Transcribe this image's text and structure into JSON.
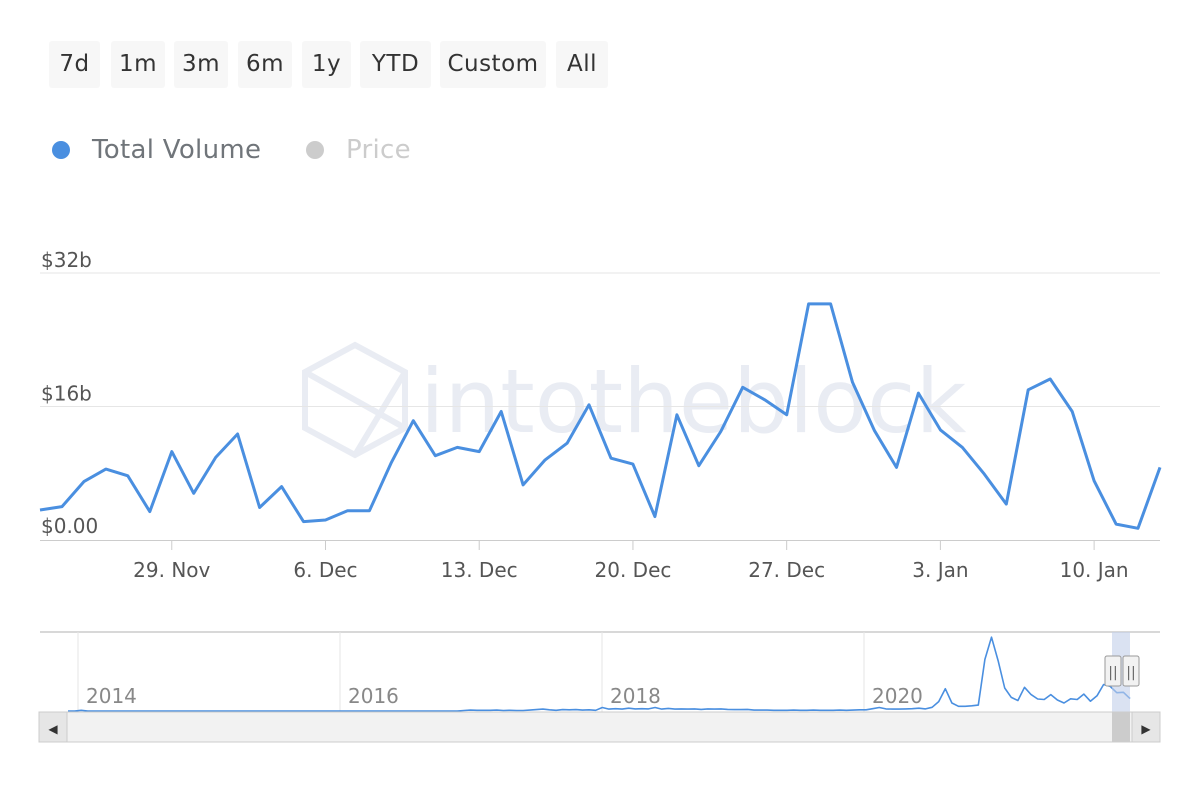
{
  "range_selector": {
    "buttons": [
      "7d",
      "1m",
      "3m",
      "6m",
      "1y",
      "YTD",
      "Custom",
      "All"
    ]
  },
  "legend": {
    "items": [
      {
        "label": "Total Volume",
        "color": "#4a8fe0",
        "active": true
      },
      {
        "label": "Price",
        "color": "#cccccc",
        "active": false
      }
    ]
  },
  "watermark": "intotheblock",
  "colors": {
    "line": "#4a8fe0",
    "grid": "#e6e6e6",
    "text": "#555555"
  },
  "chart_data": {
    "type": "line",
    "ylim": [
      0,
      32
    ],
    "y_ticks": [
      {
        "value": 0,
        "label": "$0.00"
      },
      {
        "value": 16,
        "label": "$16b"
      },
      {
        "value": 32,
        "label": "$32b"
      }
    ],
    "x_ticks": [
      "29. Nov",
      "6. Dec",
      "13. Dec",
      "20. Dec",
      "27. Dec",
      "3. Jan",
      "10. Jan"
    ],
    "series": [
      {
        "name": "Total Volume",
        "unit": "USD billions",
        "x": [
          "2020-11-23",
          "2020-11-24",
          "2020-11-25",
          "2020-11-26",
          "2020-11-27",
          "2020-11-28",
          "2020-11-29",
          "2020-11-30",
          "2020-12-01",
          "2020-12-02",
          "2020-12-03",
          "2020-12-04",
          "2020-12-05",
          "2020-12-06",
          "2020-12-07",
          "2020-12-08",
          "2020-12-09",
          "2020-12-10",
          "2020-12-11",
          "2020-12-12",
          "2020-12-13",
          "2020-12-14",
          "2020-12-15",
          "2020-12-16",
          "2020-12-17",
          "2020-12-18",
          "2020-12-19",
          "2020-12-20",
          "2020-12-21",
          "2020-12-22",
          "2020-12-23",
          "2020-12-24",
          "2020-12-25",
          "2020-12-26",
          "2020-12-27",
          "2020-12-28",
          "2020-12-29",
          "2020-12-30",
          "2020-12-31",
          "2021-01-01",
          "2021-01-02",
          "2021-01-03",
          "2021-01-04",
          "2021-01-05",
          "2021-01-06",
          "2021-01-07",
          "2021-01-08",
          "2021-01-09",
          "2021-01-10",
          "2021-01-11",
          "2021-01-12",
          "2021-01-13"
        ],
        "values": [
          3.6,
          4.0,
          7.0,
          8.5,
          7.7,
          3.4,
          10.6,
          5.6,
          9.9,
          12.7,
          3.9,
          6.4,
          2.2,
          2.4,
          3.5,
          3.5,
          9.3,
          14.3,
          10.1,
          11.1,
          10.6,
          15.4,
          6.6,
          9.6,
          11.6,
          16.2,
          9.8,
          9.1,
          2.8,
          15.0,
          8.9,
          13.0,
          18.3,
          16.8,
          15.0,
          28.3,
          28.3,
          18.9,
          13.1,
          8.7,
          17.6,
          13.2,
          11.1,
          7.9,
          4.3,
          18.0,
          19.3,
          15.4,
          7.1,
          1.9,
          1.4,
          8.7
        ]
      }
    ]
  },
  "navigator": {
    "year_labels": [
      "2014",
      "2016",
      "2018",
      "2020"
    ],
    "series_values": [
      0.0,
      0.0,
      0.3,
      0.0,
      0.0,
      0.0,
      0.0,
      0.0,
      0.0,
      0.0,
      0.0,
      0.0,
      0.0,
      0.0,
      0.0,
      0.0,
      0.0,
      0.0,
      0.0,
      0.0,
      0.0,
      0.0,
      0.0,
      0.0,
      0.0,
      0.0,
      0.0,
      0.0,
      0.0,
      0.0,
      0.0,
      0.0,
      0.0,
      0.0,
      0.0,
      0.0,
      0.0,
      0.0,
      0.0,
      0.0,
      0.0,
      0.0,
      0.0,
      0.0,
      0.0,
      0.0,
      0.0,
      0.0,
      0.0,
      0.0,
      0.0,
      0.0,
      0.0,
      0.0,
      0.0,
      0.0,
      0.0,
      0.0,
      0.0,
      0.0,
      0.2,
      0.4,
      0.3,
      0.3,
      0.3,
      0.4,
      0.2,
      0.3,
      0.2,
      0.2,
      0.4,
      0.6,
      0.8,
      0.5,
      0.3,
      0.6,
      0.5,
      0.6,
      0.4,
      0.5,
      0.3,
      1.5,
      0.8,
      1.0,
      0.8,
      1.2,
      0.9,
      1.0,
      0.9,
      1.5,
      0.8,
      1.1,
      0.8,
      0.9,
      0.8,
      0.9,
      0.7,
      0.9,
      0.8,
      0.9,
      0.7,
      0.6,
      0.6,
      0.7,
      0.4,
      0.4,
      0.4,
      0.3,
      0.3,
      0.3,
      0.4,
      0.3,
      0.3,
      0.4,
      0.3,
      0.3,
      0.3,
      0.4,
      0.3,
      0.4,
      0.5,
      0.5,
      1.0,
      1.5,
      0.9,
      0.8,
      0.8,
      0.9,
      1.0,
      1.2,
      0.9,
      1.6,
      4.0,
      9.5,
      3.4,
      2.0,
      2.0,
      2.2,
      2.5,
      22.0,
      31.5,
      21.5,
      9.8,
      5.8,
      4.5,
      10.1,
      7.0,
      5.1,
      4.9,
      7.0,
      4.7,
      3.4,
      5.2,
      4.9,
      7.2,
      4.2,
      6.5,
      11.3,
      10.5,
      7.8,
      8.0,
      5.3
    ],
    "selected_range": [
      "2020-11-23",
      "2021-01-13"
    ],
    "scroll_left": "◀",
    "scroll_right": "▶",
    "handle_glyph": "||"
  }
}
